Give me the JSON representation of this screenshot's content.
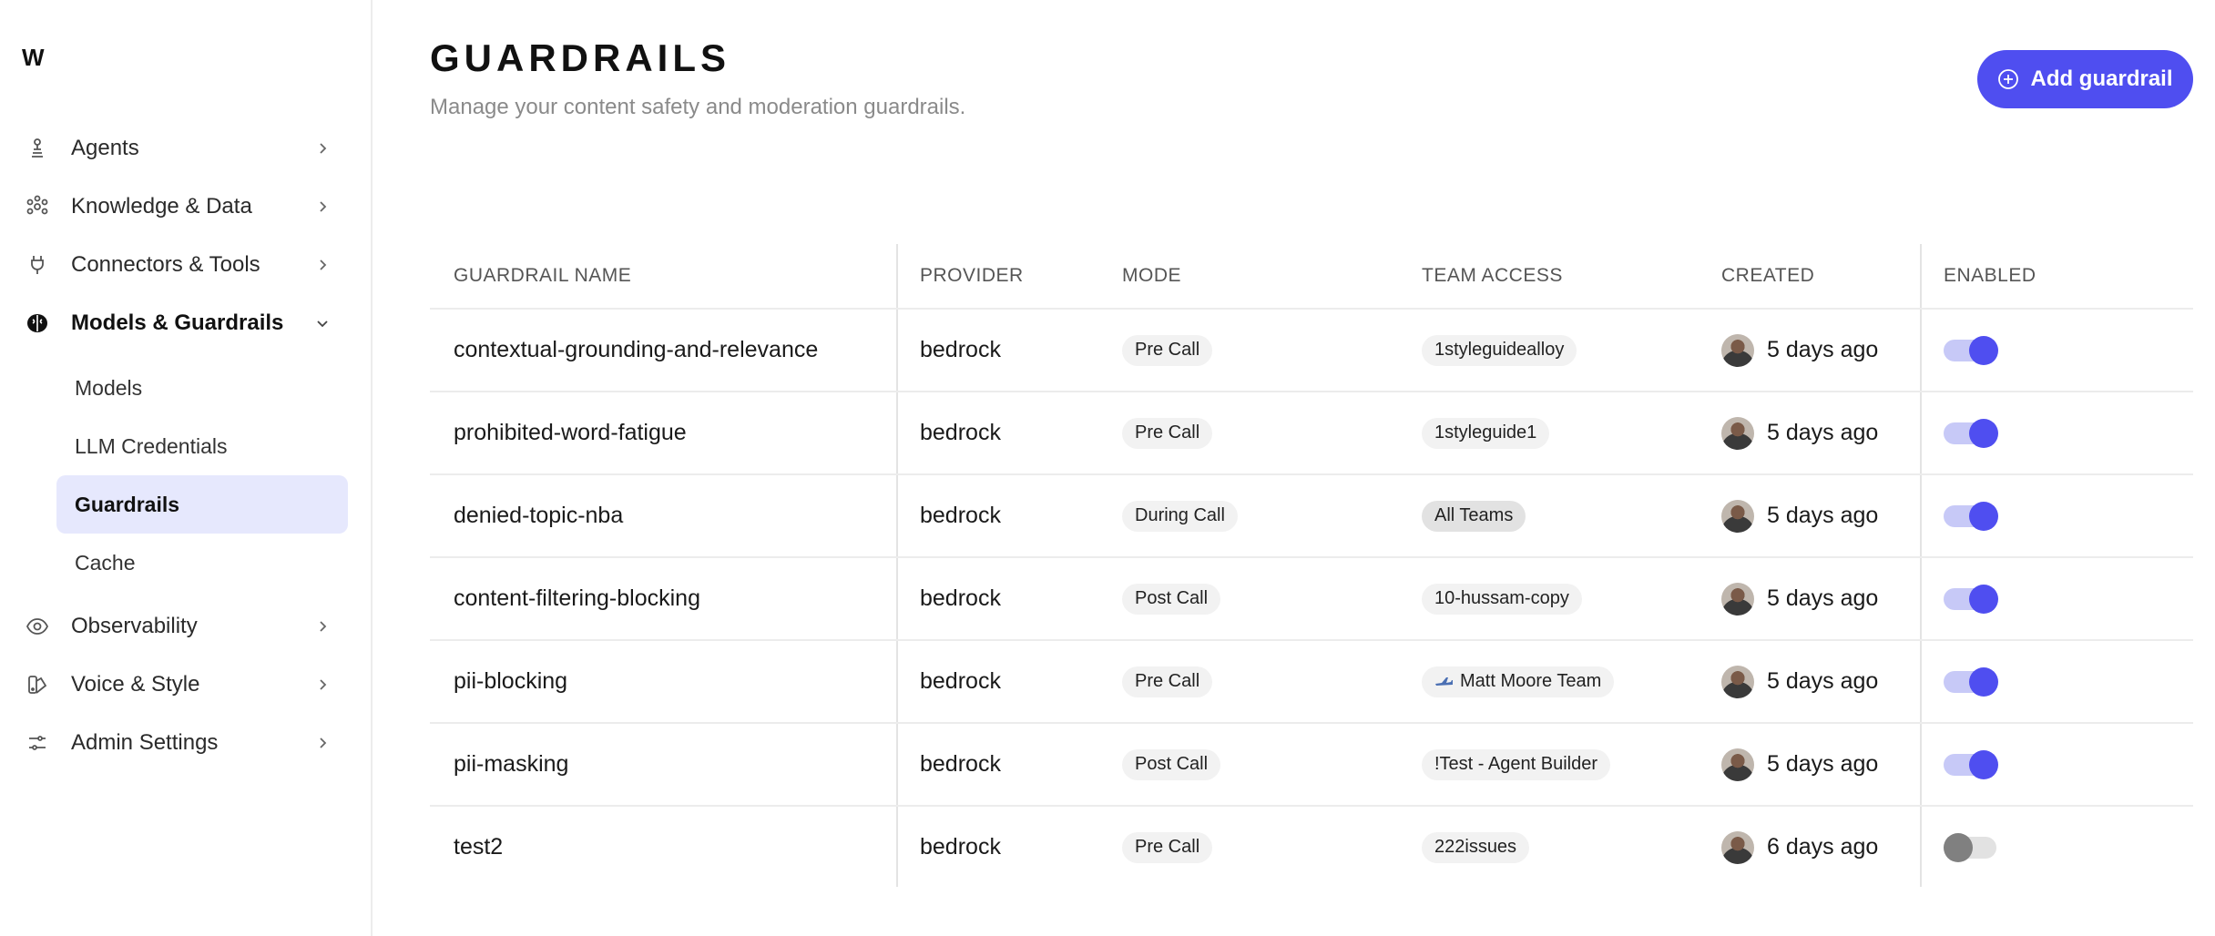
{
  "app": {
    "logo_text": "W"
  },
  "sidebar": {
    "items": [
      {
        "label": "Agents",
        "icon": "agents-icon"
      },
      {
        "label": "Knowledge & Data",
        "icon": "knowledge-icon"
      },
      {
        "label": "Connectors & Tools",
        "icon": "plug-icon"
      },
      {
        "label": "Models & Guardrails",
        "icon": "brain-icon",
        "expanded": true
      },
      {
        "label": "Observability",
        "icon": "eye-icon"
      },
      {
        "label": "Voice & Style",
        "icon": "palette-icon"
      },
      {
        "label": "Admin Settings",
        "icon": "sliders-icon"
      }
    ],
    "subitems": [
      {
        "label": "Models"
      },
      {
        "label": "LLM Credentials"
      },
      {
        "label": "Guardrails",
        "active": true
      },
      {
        "label": "Cache"
      }
    ]
  },
  "header": {
    "title": "GUARDRAILS",
    "subtitle": "Manage your content safety and moderation guardrails.",
    "add_button": "Add guardrail"
  },
  "table": {
    "columns": [
      "GUARDRAIL NAME",
      "PROVIDER",
      "MODE",
      "TEAM ACCESS",
      "CREATED",
      "ENABLED"
    ],
    "rows": [
      {
        "name": "contextual-grounding-and-relevance",
        "provider": "bedrock",
        "mode": "Pre Call",
        "team": "1styleguidealloy",
        "created": "5 days ago",
        "enabled": true
      },
      {
        "name": "prohibited-word-fatigue",
        "provider": "bedrock",
        "mode": "Pre Call",
        "team": "1styleguide1",
        "created": "5 days ago",
        "enabled": true
      },
      {
        "name": "denied-topic-nba",
        "provider": "bedrock",
        "mode": "During Call",
        "team": "All Teams",
        "created": "5 days ago",
        "enabled": true
      },
      {
        "name": "content-filtering-blocking",
        "provider": "bedrock",
        "mode": "Post Call",
        "team": "10-hussam-copy",
        "created": "5 days ago",
        "enabled": true
      },
      {
        "name": "pii-blocking",
        "provider": "bedrock",
        "mode": "Pre Call",
        "team": "Matt Moore Team",
        "created": "5 days ago",
        "enabled": true
      },
      {
        "name": "pii-masking",
        "provider": "bedrock",
        "mode": "Post Call",
        "team": "!Test - Agent Builder",
        "created": "5 days ago",
        "enabled": true
      },
      {
        "name": "test2",
        "provider": "bedrock",
        "mode": "Pre Call",
        "team": "222issues",
        "created": "6 days ago",
        "enabled": false
      }
    ]
  },
  "colors": {
    "accent": "#4f4ef0",
    "accent_light": "#e6e8fd"
  }
}
